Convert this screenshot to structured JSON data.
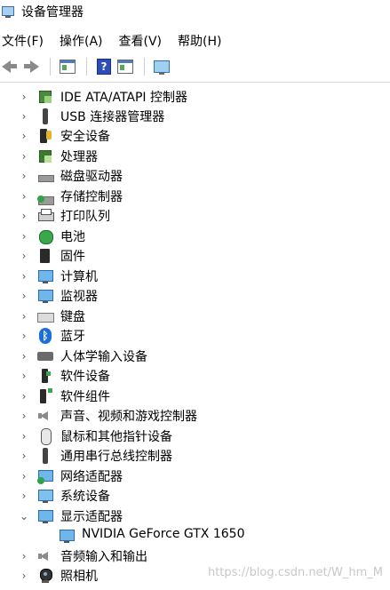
{
  "window": {
    "title": "设备管理器"
  },
  "menubar": [
    {
      "label": "文件(F)"
    },
    {
      "label": "操作(A)"
    },
    {
      "label": "查看(V)"
    },
    {
      "label": "帮助(H)"
    }
  ],
  "toolbar": {
    "buttons": [
      {
        "icon": "back-arrow-icon"
      },
      {
        "icon": "forward-arrow-icon"
      },
      {
        "icon": "properties-icon"
      },
      {
        "icon": "help-icon"
      },
      {
        "icon": "update-driver-icon"
      },
      {
        "icon": "scan-hardware-icon"
      }
    ]
  },
  "tree": {
    "items": [
      {
        "label": "IDE ATA/ATAPI 控制器",
        "icon": "ide-controller-icon",
        "expanded": false
      },
      {
        "label": "USB 连接器管理器",
        "icon": "usb-plug-icon",
        "expanded": false
      },
      {
        "label": "安全设备",
        "icon": "security-device-icon",
        "expanded": false
      },
      {
        "label": "处理器",
        "icon": "processor-icon",
        "expanded": false
      },
      {
        "label": "磁盘驱动器",
        "icon": "disk-drive-icon",
        "expanded": false
      },
      {
        "label": "存储控制器",
        "icon": "storage-controller-icon",
        "expanded": false
      },
      {
        "label": "打印队列",
        "icon": "printer-icon",
        "expanded": false
      },
      {
        "label": "电池",
        "icon": "battery-icon",
        "expanded": false
      },
      {
        "label": "固件",
        "icon": "firmware-icon",
        "expanded": false
      },
      {
        "label": "计算机",
        "icon": "computer-icon",
        "expanded": false
      },
      {
        "label": "监视器",
        "icon": "monitor-icon",
        "expanded": false
      },
      {
        "label": "键盘",
        "icon": "keyboard-icon",
        "expanded": false
      },
      {
        "label": "蓝牙",
        "icon": "bluetooth-icon",
        "expanded": false
      },
      {
        "label": "人体学输入设备",
        "icon": "hid-icon",
        "expanded": false
      },
      {
        "label": "软件设备",
        "icon": "software-device-icon",
        "expanded": false
      },
      {
        "label": "软件组件",
        "icon": "software-component-icon",
        "expanded": false
      },
      {
        "label": "声音、视频和游戏控制器",
        "icon": "sound-icon",
        "expanded": false
      },
      {
        "label": "鼠标和其他指针设备",
        "icon": "mouse-icon",
        "expanded": false
      },
      {
        "label": "通用串行总线控制器",
        "icon": "usb-controller-icon",
        "expanded": false
      },
      {
        "label": "网络适配器",
        "icon": "network-adapter-icon",
        "expanded": false
      },
      {
        "label": "系统设备",
        "icon": "system-device-icon",
        "expanded": false
      },
      {
        "label": "显示适配器",
        "icon": "display-adapter-icon",
        "expanded": true
      },
      {
        "label": "NVIDIA GeForce GTX 1650",
        "icon": "gpu-icon",
        "child": true
      },
      {
        "label": "音频输入和输出",
        "icon": "audio-io-icon",
        "expanded": false
      },
      {
        "label": "照相机",
        "icon": "camera-icon",
        "expanded": false
      }
    ]
  },
  "watermark": "https://blog.csdn.net/W_hm_M"
}
